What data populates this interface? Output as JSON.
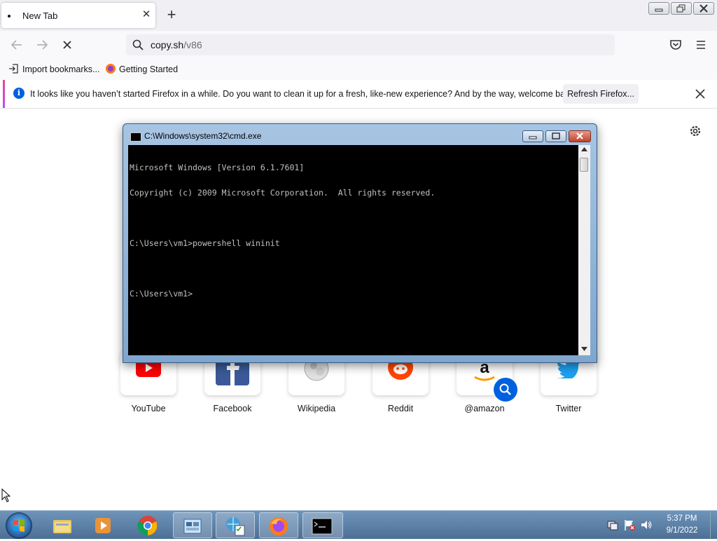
{
  "browser": {
    "tab": {
      "title": "New Tab"
    },
    "url": {
      "host": "copy.sh",
      "path": "/v86"
    },
    "bookmarks": [
      {
        "label": "Import bookmarks..."
      },
      {
        "label": "Getting Started"
      }
    ],
    "notification": {
      "message": "It looks like you haven’t started Firefox in a while. Do you want to clean it up for a fresh, like-new experience? And by the way, welcome back!",
      "button": "Refresh Firefox..."
    },
    "top_sites": [
      {
        "label": "YouTube"
      },
      {
        "label": "Facebook"
      },
      {
        "label": "Wikipedia"
      },
      {
        "label": "Reddit"
      },
      {
        "label": "@amazon"
      },
      {
        "label": "Twitter"
      }
    ]
  },
  "cmd": {
    "title": "C:\\Windows\\system32\\cmd.exe",
    "lines": [
      "Microsoft Windows [Version 6.1.7601]",
      "Copyright (c) 2009 Microsoft Corporation.  All rights reserved.",
      "",
      "C:\\Users\\vm1>powershell wininit",
      "",
      "C:\\Users\\vm1>"
    ]
  },
  "taskbar": {
    "clock": {
      "time": "5:37 PM",
      "date": "9/1/2022"
    }
  },
  "colors": {
    "accent": "#0060df",
    "taskbar": "#4c6f95"
  }
}
